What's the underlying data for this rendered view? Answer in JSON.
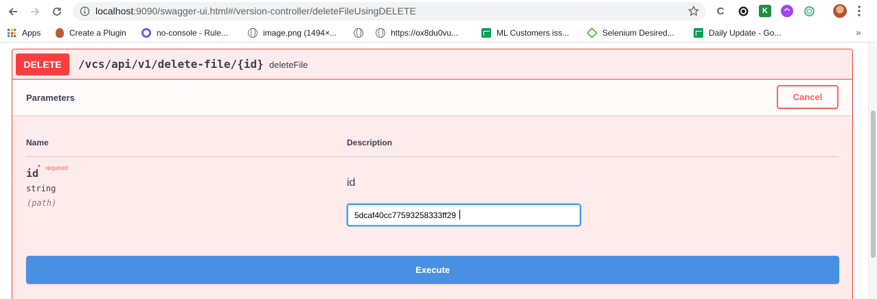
{
  "browser": {
    "url_host": "localhost",
    "url_rest": ":9090/swagger-ui.html#/version-controller/deleteFileUsingDELETE",
    "extension_letters": [
      "C",
      "G",
      "K"
    ]
  },
  "bookmarks": [
    {
      "label": "Apps",
      "icon": "apps-grid-icon"
    },
    {
      "label": "Create a Plugin",
      "icon": "plugin-icon"
    },
    {
      "label": "no-console - Rule...",
      "icon": "eslint-icon"
    },
    {
      "label": "image.png (1494×...",
      "icon": "globe-icon"
    },
    {
      "label": "https://ox8du0vu...",
      "icon": "globe-icon"
    },
    {
      "label": "ML Customers iss...",
      "icon": "sheets-icon"
    },
    {
      "label": "Selenium Desired...",
      "icon": "selenium-icon"
    },
    {
      "label": "Daily Update - Go...",
      "icon": "sheets-icon"
    }
  ],
  "bookmarks_overflow": "»",
  "operation": {
    "method": "DELETE",
    "path": "/vcs/api/v1/delete-file/{id}",
    "summary": "deleteFile",
    "color": "#f93e3e"
  },
  "parameters": {
    "title": "Parameters",
    "cancel_label": "Cancel",
    "col_name": "Name",
    "col_description": "Description",
    "items": [
      {
        "name": "id",
        "required_star": "*",
        "required_label": "required",
        "type": "string",
        "in": "(path)",
        "description": "id",
        "value": "5dcaf40cc77593258333ff29"
      }
    ]
  },
  "execute_label": "Execute",
  "accent_color": "#4990e2"
}
